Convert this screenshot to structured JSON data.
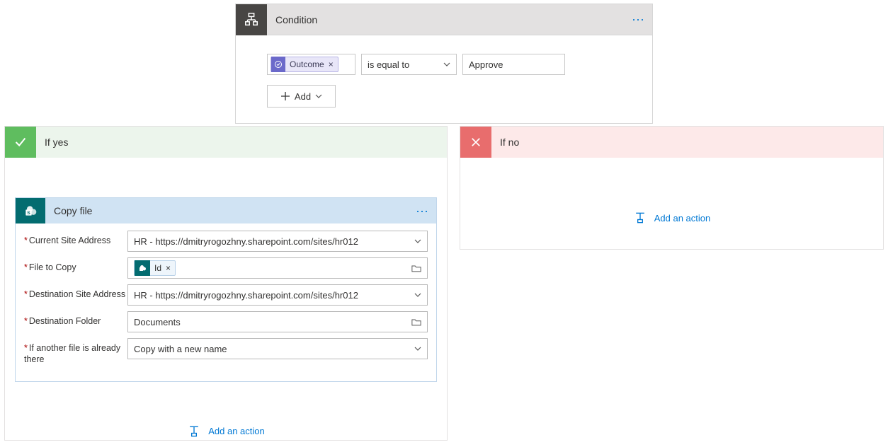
{
  "condition": {
    "title": "Condition",
    "token_label": "Outcome",
    "token_x": "×",
    "operator": "is equal to",
    "value": "Approve",
    "add_label": "Add"
  },
  "yes_branch": {
    "title": "If yes",
    "action": {
      "title": "Copy file",
      "fields": {
        "current_site_label": "Current Site Address",
        "current_site_value": "HR - https://dmitryrogozhny.sharepoint.com/sites/hr012",
        "file_to_copy_label": "File to Copy",
        "file_to_copy_token": "Id",
        "file_to_copy_x": "×",
        "dest_site_label": "Destination Site Address",
        "dest_site_value": "HR - https://dmitryrogozhny.sharepoint.com/sites/hr012",
        "dest_folder_label": "Destination Folder",
        "dest_folder_value": "Documents",
        "overwrite_label": "If another file is already there",
        "overwrite_value": "Copy with a new name"
      }
    },
    "add_action": "Add an action"
  },
  "no_branch": {
    "title": "If no",
    "add_action": "Add an action"
  }
}
